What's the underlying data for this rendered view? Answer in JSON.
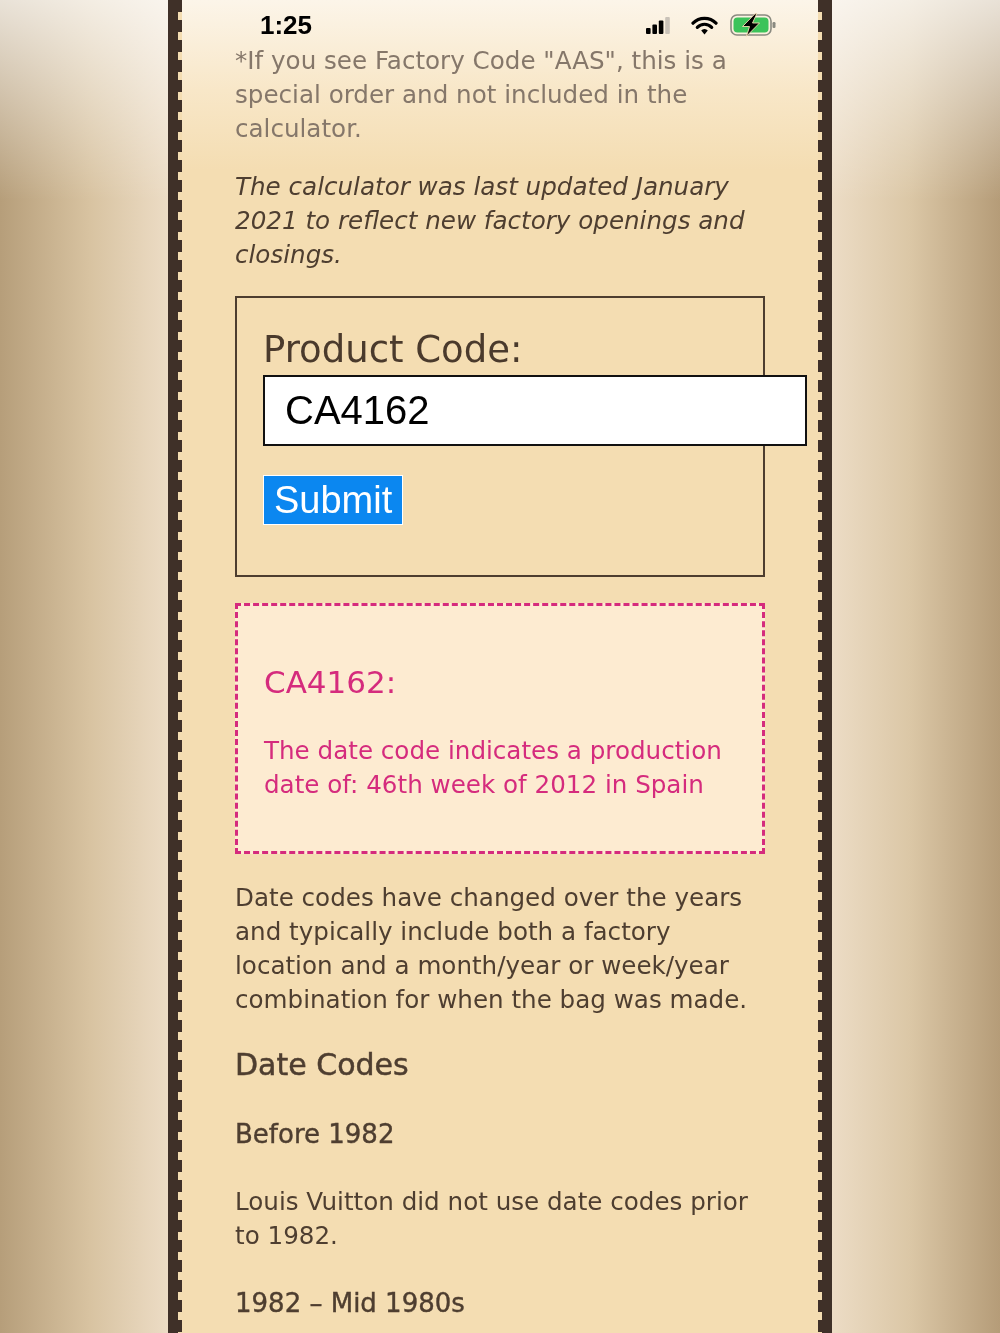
{
  "status_bar": {
    "time": "1:25"
  },
  "notes": [
    {
      "kind": "footnote",
      "text": "*If you see Factory Code \"AAS\", this is a special order and not included in the calculator."
    },
    {
      "kind": "emphasis",
      "text": "The calculator was last updated January 2021 to reflect new factory openings and closings."
    }
  ],
  "form": {
    "label": "Product Code:",
    "input": {
      "value": "CA4162"
    },
    "submit": "Submit"
  },
  "result": {
    "code": "CA4162:",
    "message": "The date code indicates a production date of: 46th week of 2012 in Spain"
  },
  "article": [
    {
      "kind": "paragraph",
      "text": "Date codes have changed over the years and typically include both a factory location and a month/year or week/year combination for when the bag was made."
    },
    {
      "kind": "heading",
      "text": "Date Codes"
    },
    {
      "kind": "subheading",
      "text": "Before 1982"
    },
    {
      "kind": "paragraph",
      "text": "Louis Vuitton did not use date codes prior to 1982."
    },
    {
      "kind": "subheading",
      "text": "1982 – Mid 1980s"
    }
  ]
}
